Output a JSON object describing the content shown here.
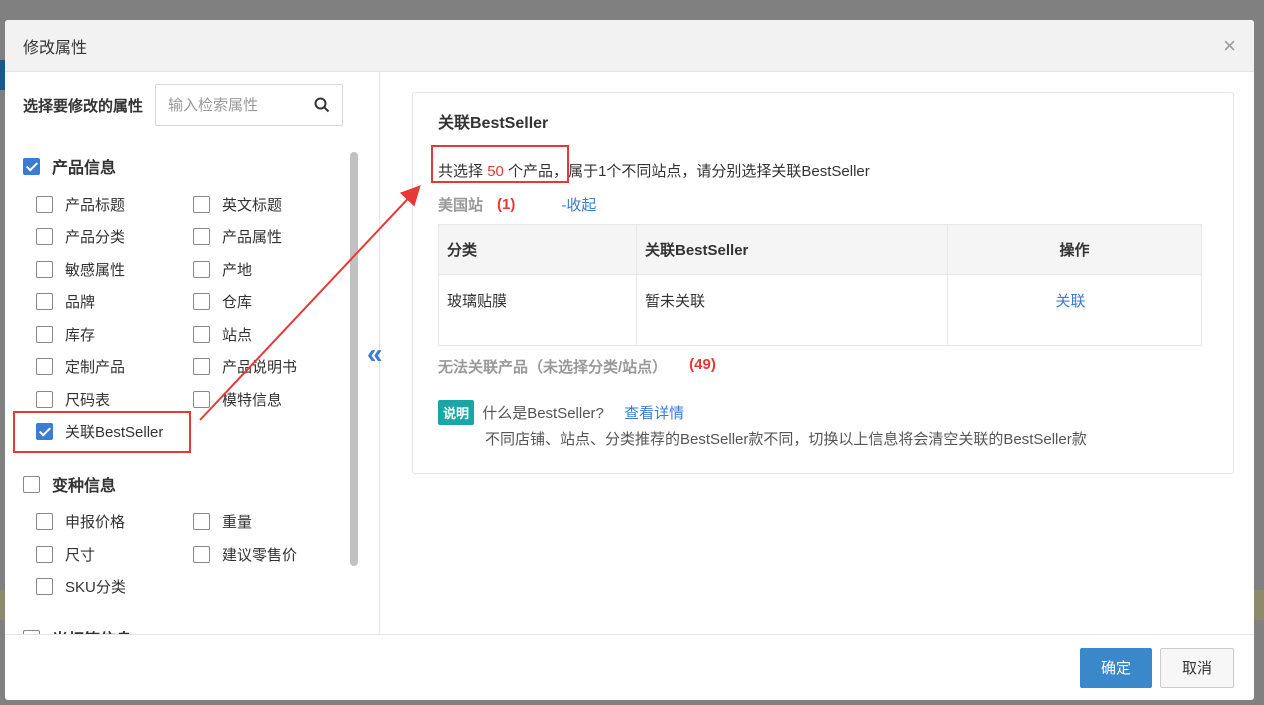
{
  "modal": {
    "title": "修改属性",
    "close_glyph": "×"
  },
  "left": {
    "select_label": "选择要修改的属性",
    "search_placeholder": "输入检索属性",
    "groups": [
      {
        "title": "产品信息",
        "checked": true,
        "items": [
          {
            "label": "产品标题",
            "checked": false
          },
          {
            "label": "英文标题",
            "checked": false
          },
          {
            "label": "产品分类",
            "checked": false
          },
          {
            "label": "产品属性",
            "checked": false
          },
          {
            "label": "敏感属性",
            "checked": false
          },
          {
            "label": "产地",
            "checked": false
          },
          {
            "label": "品牌",
            "checked": false
          },
          {
            "label": "仓库",
            "checked": false
          },
          {
            "label": "库存",
            "checked": false
          },
          {
            "label": "站点",
            "checked": false
          },
          {
            "label": "定制产品",
            "checked": false
          },
          {
            "label": "产品说明书",
            "checked": false
          },
          {
            "label": "尺码表",
            "checked": false
          },
          {
            "label": "模特信息",
            "checked": false
          },
          {
            "label": "关联BestSeller",
            "checked": true
          }
        ]
      },
      {
        "title": "变种信息",
        "checked": false,
        "items": [
          {
            "label": "申报价格",
            "checked": false
          },
          {
            "label": "重量",
            "checked": false
          },
          {
            "label": "尺寸",
            "checked": false
          },
          {
            "label": "建议零售价",
            "checked": false
          },
          {
            "label": "SKU分类",
            "checked": false
          }
        ]
      },
      {
        "title": "光杆箱信息",
        "checked": false,
        "items": []
      }
    ]
  },
  "right": {
    "card_title": "关联BestSeller",
    "summary_prefix": "共选择",
    "summary_count": "50",
    "summary_mid": "个产品，",
    "summary_suffix": "属于1个不同站点，请分别选择关联BestSeller",
    "site_name": "美国站",
    "site_count": "(1)",
    "collapse_label": "-收起",
    "table": {
      "headers": [
        "分类",
        "关联BestSeller",
        "操作"
      ],
      "rows": [
        {
          "category": "玻璃贴膜",
          "bestseller": "暂未关联",
          "action": "关联"
        }
      ]
    },
    "unlinked_label": "无法关联产品（未选择分类/站点）",
    "unlinked_count": "(49)",
    "note_badge": "说明",
    "note_question": "什么是BestSeller?",
    "note_more": "查看详情",
    "note_desc": "不同店铺、站点、分类推荐的BestSeller款不同，切换以上信息将会清空关联的BestSeller款"
  },
  "footer": {
    "confirm": "确定",
    "cancel": "取消"
  },
  "colors": {
    "accent": "#3a7bd5",
    "highlight": "#e53935",
    "badge": "#1aa6a6"
  }
}
